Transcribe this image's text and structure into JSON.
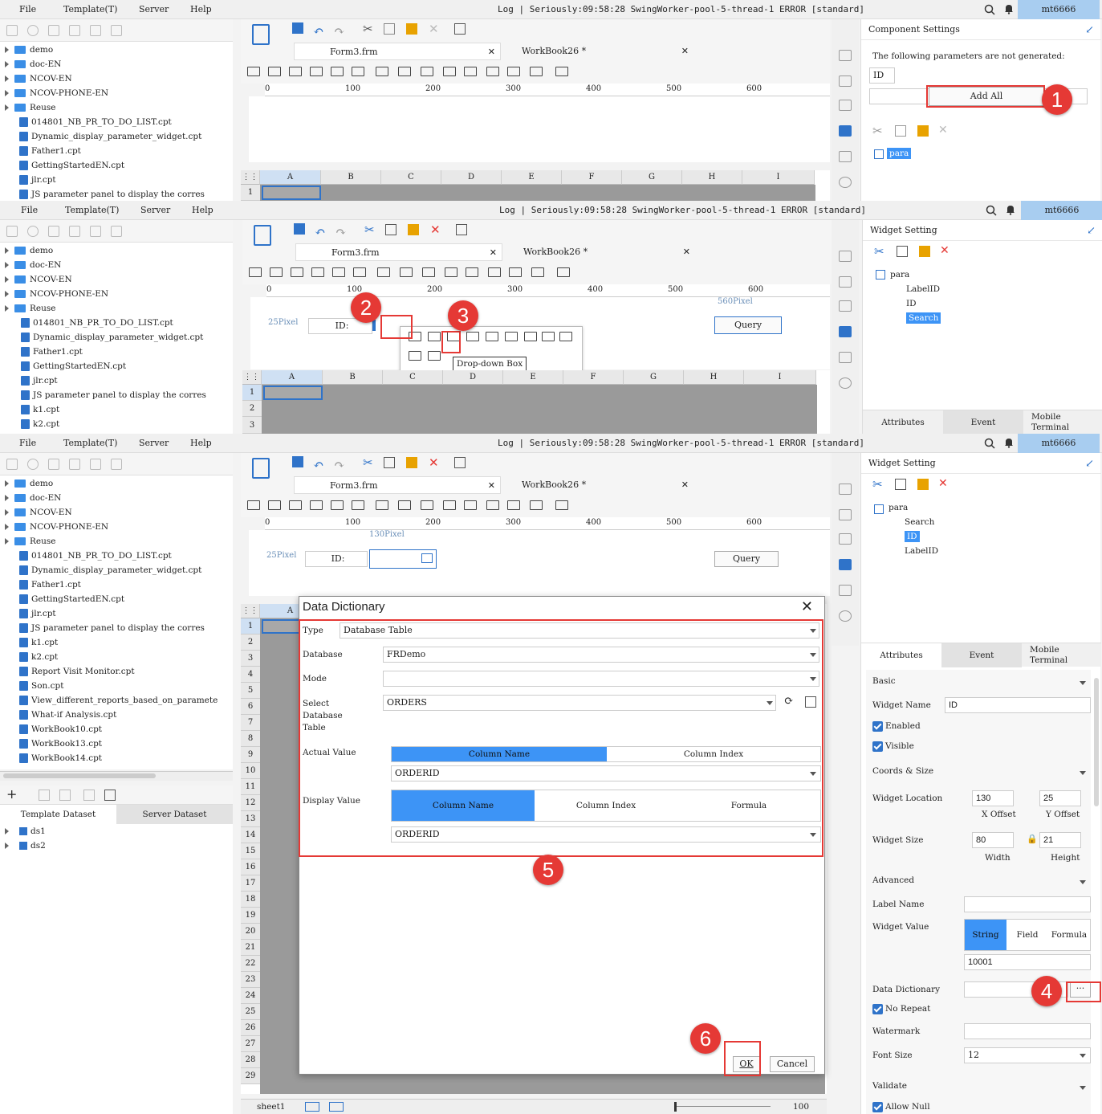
{
  "menu": {
    "file": "File",
    "template": "Template(T)",
    "server": "Server",
    "help": "Help"
  },
  "log_text": "Log | Seriously:09:58:28 SwingWorker-pool-5-thread-1 ERROR [standard]",
  "user": "mt6666",
  "tree_items": [
    "demo",
    "doc-EN",
    "NCOV-EN",
    "NCOV-PHONE-EN",
    "Reuse",
    "014801_NB_PR_TO_DO_LIST.cpt",
    "Dynamic_display_parameter_widget.cpt",
    "Father1.cpt",
    "GettingStartedEN.cpt",
    "jlr.cpt",
    "JS parameter panel to display the corres",
    "k1.cpt",
    "k2.cpt",
    "Report Visit Monitor.cpt",
    "Son.cpt",
    "View_different_reports_based_on_paramete",
    "What-if Analysis.cpt",
    "WorkBook10.cpt",
    "WorkBook13.cpt",
    "WorkBook14.cpt"
  ],
  "tabs": {
    "form": "Form3.frm",
    "workbook": "WorkBook26 *"
  },
  "ruler": [
    "0",
    "100",
    "200",
    "300",
    "400",
    "500",
    "600"
  ],
  "columns": [
    "A",
    "B",
    "C",
    "D",
    "E",
    "F",
    "G",
    "H",
    "I"
  ],
  "rows": [
    "1",
    "2",
    "3",
    "4",
    "5",
    "6",
    "7",
    "8",
    "9",
    "10",
    "11",
    "12",
    "13",
    "14",
    "15",
    "16",
    "17",
    "18",
    "19",
    "20",
    "21",
    "22",
    "23",
    "24",
    "25",
    "26",
    "27",
    "28",
    "29"
  ],
  "panel1": {
    "title": "Component Settings",
    "notice": "The following parameters are not generated:",
    "param": "ID",
    "add_all": "Add All",
    "widget": "para"
  },
  "panel2": {
    "title": "Widget Setting",
    "tree": [
      "para",
      "LabelID",
      "ID",
      "Search"
    ],
    "canvas_label": "ID:",
    "pixel_left": "25Pixel",
    "pixel_right": "560Pixel",
    "query": "Query",
    "tooltip": "Drop-down Box",
    "tabs": [
      "Attributes",
      "Event",
      "Mobile Terminal"
    ]
  },
  "panel3": {
    "title": "Widget Setting",
    "tree": [
      "para",
      "Search",
      "ID",
      "LabelID"
    ],
    "canvas_label": "ID:",
    "pixel_left": "25Pixel",
    "pixel_top": "130Pixel",
    "query": "Query",
    "dataset_tabs": [
      "Template Dataset",
      "Server Dataset"
    ],
    "datasets": [
      "ds1",
      "ds2"
    ],
    "tabs": [
      "Attributes",
      "Event",
      "Mobile Terminal"
    ],
    "basic": "Basic",
    "widget_name_label": "Widget Name",
    "widget_name": "ID",
    "enabled": "Enabled",
    "visible": "Visible",
    "coords": "Coords & Size",
    "location_label": "Widget Location",
    "x": "130",
    "y": "25",
    "x_label": "X Offset",
    "y_label": "Y Offset",
    "size_label": "Widget Size",
    "w": "80",
    "h": "21",
    "w_label": "Width",
    "h_label": "Height",
    "advanced": "Advanced",
    "label_name": "Label Name",
    "widget_value": "Widget Value",
    "value_modes": [
      "String",
      "Field",
      "Formula"
    ],
    "value": "10001",
    "data_dict": "Data Dictionary",
    "no_repeat": "No Repeat",
    "watermark": "Watermark",
    "font_size_label": "Font Size",
    "font_size": "12",
    "validate": "Validate",
    "allow_null": "Allow Null",
    "sheet": "sheet1",
    "zoom": "100"
  },
  "dialog": {
    "title": "Data Dictionary",
    "type_label": "Type",
    "type": "Database Table",
    "database_label": "Database",
    "database": "FRDemo",
    "mode_label": "Mode",
    "table_label": "Select Database Table",
    "table": "ORDERS",
    "actual_label": "Actual Value",
    "actual_modes": [
      "Column Name",
      "Column Index"
    ],
    "actual": "ORDERID",
    "display_label": "Display Value",
    "display_modes": [
      "Column Name",
      "Column Index",
      "Formula"
    ],
    "display": "ORDERID",
    "ok": "OK",
    "cancel": "Cancel"
  },
  "callouts": [
    "1",
    "2",
    "3",
    "4",
    "5",
    "6"
  ],
  "accent": "#3d94f6",
  "callout_color": "#e53935"
}
